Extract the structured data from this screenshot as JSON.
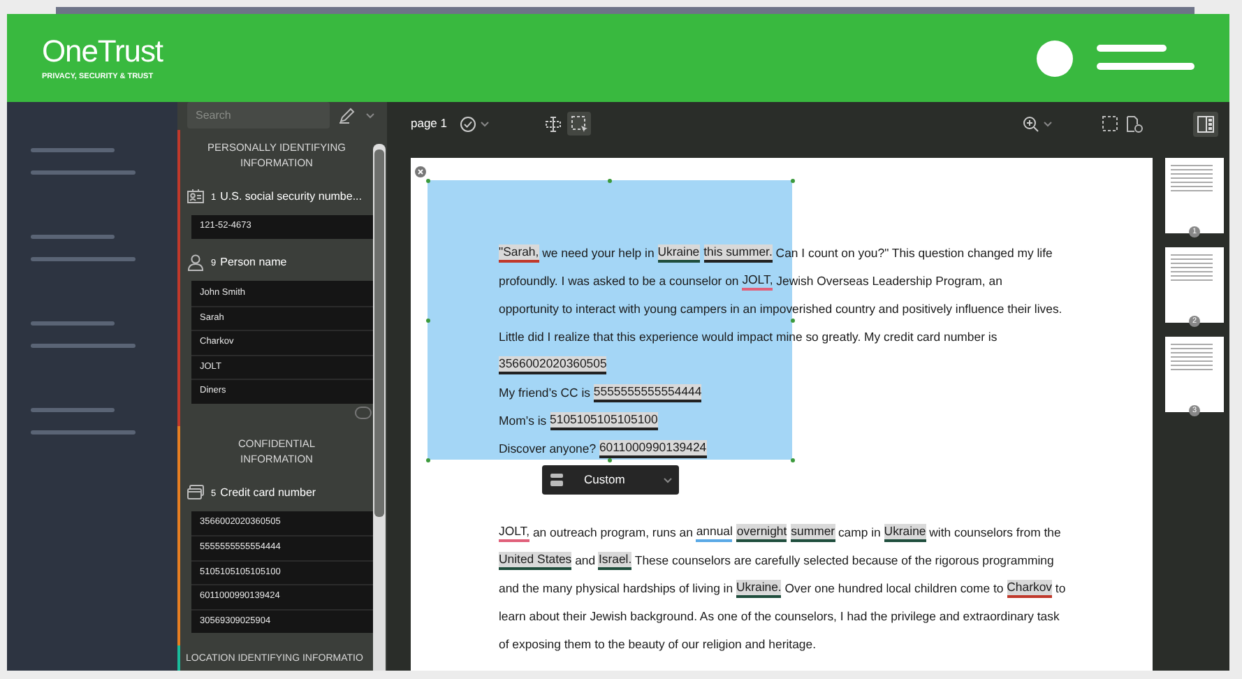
{
  "header": {
    "logo": "OneTrust",
    "tagline": "PRIVACY, SECURITY & TRUST"
  },
  "sidebar": {
    "search": {
      "placeholder": "Search"
    },
    "sections": [
      {
        "title": "PERSONALLY IDENTIFYING INFORMATION",
        "color": "#c0392b",
        "more": true,
        "categories": [
          {
            "kind": "id-card",
            "count": "1",
            "name": "U.S. social security numbe...",
            "values": [
              "121-52-4673"
            ]
          },
          {
            "kind": "person",
            "count": "9",
            "name": "Person name",
            "values": [
              "John Smith",
              "Sarah",
              "Charkov",
              "JOLT",
              "Diners"
            ]
          }
        ]
      },
      {
        "title": "CONFIDENTIAL INFORMATION",
        "color": "#e67e22",
        "more": false,
        "categories": [
          {
            "kind": "credit-card",
            "count": "5",
            "name": "Credit card number",
            "values": [
              "3566002020360505",
              "5555555555554444",
              "5105105105105100",
              "6011000990139424",
              "30569309025904"
            ]
          }
        ]
      },
      {
        "title": "LOCATION IDENTIFYING INFORMATIO",
        "color": "#1abc9c",
        "more": false
      }
    ]
  },
  "toolbar": {
    "page_label": "page 1",
    "tools": [
      {
        "kind": "text-select",
        "selected": false
      },
      {
        "kind": "area-select",
        "selected": true
      }
    ],
    "panel_toggle": {
      "selected": true
    }
  },
  "selection": {
    "label": "Custom"
  },
  "document": {
    "paragraphs": [
      [
        [
          {
            "text": "\"Sarah,",
            "color": "#c0392b",
            "shaded": true
          },
          {
            "text": " we need your help in "
          },
          {
            "text": "Ukraine",
            "color": "#1f4e3d",
            "shaded": true
          },
          {
            "text": "this summer.",
            "color": "#222222",
            "shaded": true
          },
          {
            "text": " Can I count on you?\" This question changed my life"
          }
        ],
        [
          {
            "text": "profoundly. I was asked to be a counselor on "
          },
          {
            "text": "JOLT,",
            "color": "#e0607a",
            "shaded": false
          },
          {
            "text": " Jewish Overseas Leadership Program, an"
          }
        ],
        [
          {
            "text": "opportunity to interact with young campers in an impoverished country and positively influence their lives."
          }
        ],
        [
          {
            "text": "Little did I realize that this experience would impact mine so greatly. My credit card number is"
          }
        ],
        [
          {
            "text": "3566002020360505",
            "color": "#222222",
            "shaded": true
          }
        ],
        [
          {
            "text": "My friend’s CC is "
          },
          {
            "text": "5555555555554444",
            "color": "#222222",
            "shaded": true
          }
        ],
        [
          {
            "text": "Mom’s is "
          },
          {
            "text": "5105105105105100",
            "color": "#222222",
            "shaded": true
          }
        ],
        [
          {
            "text": "Discover anyone? "
          },
          {
            "text": "6011000990139424",
            "color": "#222222",
            "shaded": true
          }
        ]
      ],
      [
        [
          {
            "text": "JOLT,",
            "color": "#e0607a",
            "shaded": false
          },
          {
            "text": " an outreach program, runs an "
          },
          {
            "text": "annual",
            "color": "#5aa9e6",
            "shaded": false
          },
          {
            "text": "overnight",
            "color": "#1f4e3d",
            "shaded": true
          },
          {
            "text": "summer",
            "color": "#1f4e3d",
            "shaded": true
          },
          {
            "text": " camp in "
          },
          {
            "text": "Ukraine",
            "color": "#1f4e3d",
            "shaded": true
          },
          {
            "text": " with counselors from the"
          }
        ],
        [
          {
            "text": "United States",
            "color": "#1f4e3d",
            "shaded": true
          },
          {
            "text": " and "
          },
          {
            "text": "Israel.",
            "color": "#1f4e3d",
            "shaded": true
          },
          {
            "text": " These counselors are carefully selected because of the rigorous programming"
          }
        ],
        [
          {
            "text": "and the many physical hardships of living in "
          },
          {
            "text": "Ukraine.",
            "color": "#1f4e3d",
            "shaded": true
          },
          {
            "text": " Over one hundred local children come to "
          },
          {
            "text": "Charkov",
            "color": "#c0392b",
            "shaded": true
          },
          {
            "text": " to"
          }
        ],
        [
          {
            "text": "learn about their Jewish background. As one of the counselors, I had the privilege and extraordinary task"
          }
        ],
        [
          {
            "text": "of exposing them to the beauty of our religion and heritage."
          }
        ]
      ]
    ]
  },
  "thumbnails": [
    {
      "number": "1"
    },
    {
      "number": "2"
    },
    {
      "number": "3"
    }
  ]
}
